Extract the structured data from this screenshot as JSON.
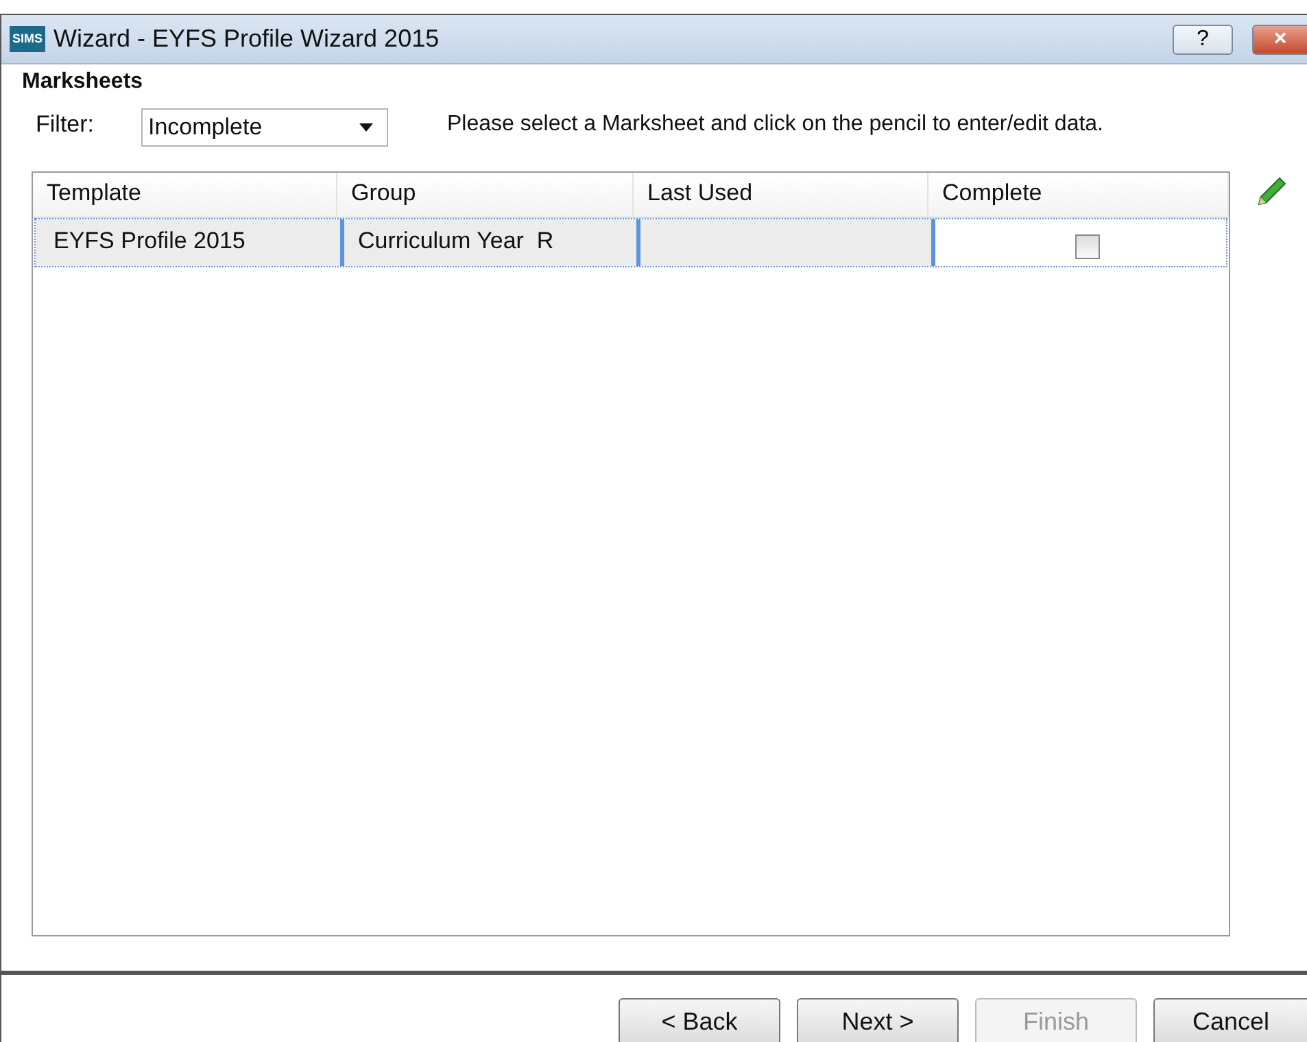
{
  "window": {
    "logo": "SIMS",
    "title": "Wizard - EYFS Profile Wizard 2015",
    "help": "?",
    "close": "×"
  },
  "section_title": "Marksheets",
  "filter": {
    "label": "Filter:",
    "value": "Incomplete"
  },
  "instruction": "Please select a Marksheet and click on the pencil to enter/edit data.",
  "table": {
    "columns": [
      "Template",
      "Group",
      "Last Used",
      "Complete"
    ],
    "rows": [
      {
        "template": "EYFS Profile 2015",
        "group": "Curriculum Year  R",
        "last_used": "",
        "complete": false,
        "selected": true
      }
    ]
  },
  "buttons": [
    {
      "label": "< Back",
      "disabled": false
    },
    {
      "label": "Next >",
      "disabled": false
    },
    {
      "label": "Finish",
      "disabled": true
    },
    {
      "label": "Cancel",
      "disabled": false
    }
  ]
}
